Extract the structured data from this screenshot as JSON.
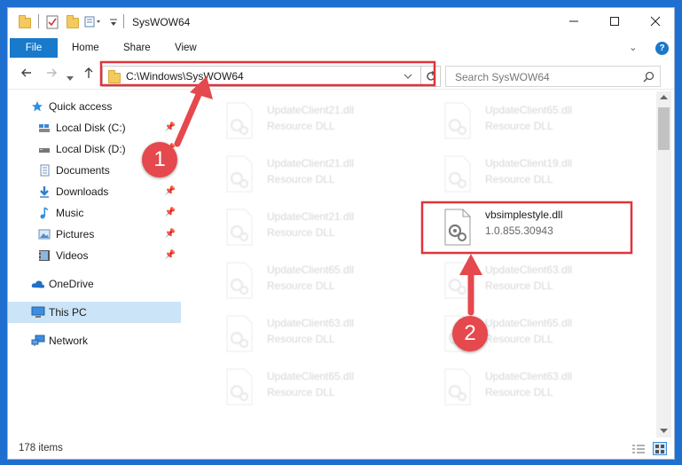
{
  "window": {
    "title": "SysWOW64",
    "minimize_icon": "minimize-icon",
    "maximize_icon": "maximize-icon",
    "close_icon": "close-icon"
  },
  "ribbon": {
    "tabs": [
      "File",
      "Home",
      "Share",
      "View"
    ],
    "help_glyph": "?",
    "expand_glyph": "⌄"
  },
  "nav": {
    "address": "C:\\Windows\\SysWOW64",
    "search_placeholder": "Search SysWOW64"
  },
  "sidebar": {
    "items": [
      {
        "label": "Quick access",
        "icon": "star-icon",
        "pinned": false
      },
      {
        "label": "Local Disk (C:)",
        "icon": "drive-icon",
        "pinned": true
      },
      {
        "label": "Local Disk (D:)",
        "icon": "drive-icon",
        "pinned": true
      },
      {
        "label": "Documents",
        "icon": "documents-icon",
        "pinned": true
      },
      {
        "label": "Downloads",
        "icon": "download-icon",
        "pinned": true
      },
      {
        "label": "Music",
        "icon": "music-icon",
        "pinned": true
      },
      {
        "label": "Pictures",
        "icon": "pictures-icon",
        "pinned": true
      },
      {
        "label": "Videos",
        "icon": "videos-icon",
        "pinned": true
      },
      {
        "label": "OneDrive",
        "icon": "cloud-icon",
        "pinned": false
      },
      {
        "label": "This PC",
        "icon": "computer-icon",
        "pinned": false
      },
      {
        "label": "Network",
        "icon": "network-icon",
        "pinned": false
      }
    ]
  },
  "files": [
    {
      "name": "UpdateClient21.dll",
      "desc": "Resource DLL"
    },
    {
      "name": "UpdateClient65.dll",
      "desc": "Resource DLL"
    },
    {
      "name": "UpdateClient21.dll",
      "desc": "Resource DLL"
    },
    {
      "name": "UpdateClient19.dll",
      "desc": "Resource DLL"
    },
    {
      "name": "UpdateClient21.dll",
      "desc": "Resource DLL"
    },
    {
      "name": "vbsimplestyle.dll",
      "desc": "1.0.855.30943"
    },
    {
      "name": "UpdateClient65.dll",
      "desc": "Resource DLL"
    },
    {
      "name": "UpdateClient63.dll",
      "desc": "Resource DLL"
    },
    {
      "name": "UpdateClient63.dll",
      "desc": "Resource DLL"
    },
    {
      "name": "UpdateClient65.dll",
      "desc": "Resource DLL"
    },
    {
      "name": "UpdateClient65.dll",
      "desc": "Resource DLL"
    },
    {
      "name": "UpdateClient63.dll",
      "desc": "Resource DLL"
    }
  ],
  "status": {
    "count": "178 items"
  },
  "callouts": {
    "step1": "1",
    "step2": "2",
    "color": "#e0333d"
  }
}
